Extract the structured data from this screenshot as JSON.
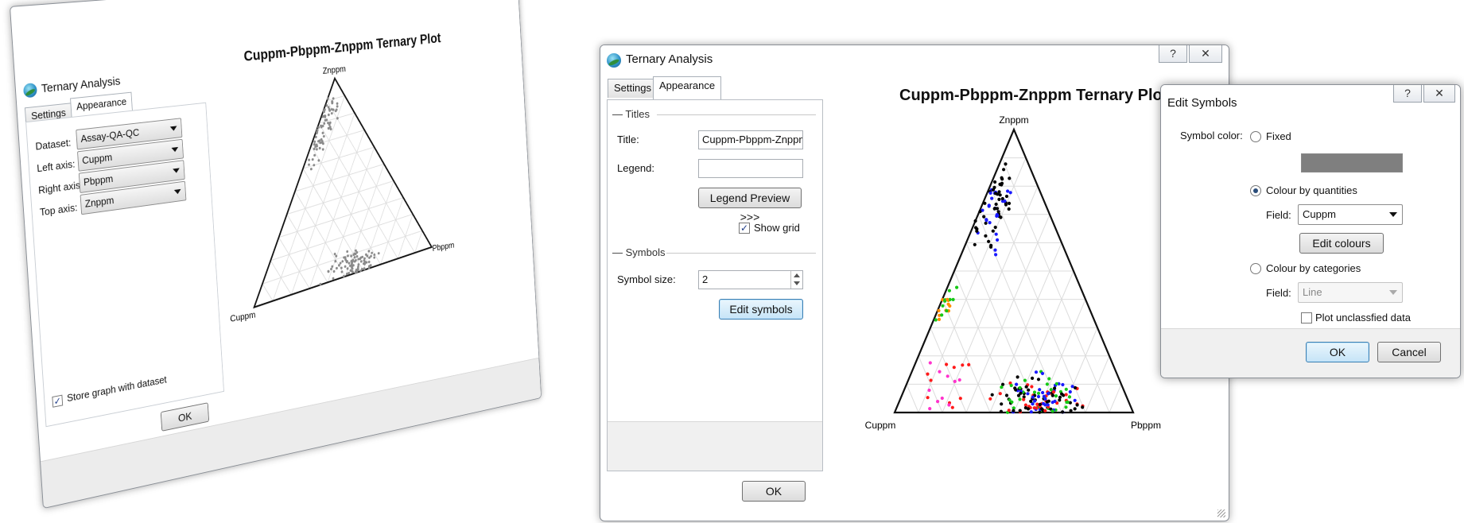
{
  "window_back": {
    "title": "Ternary Analysis",
    "help_glyph": "?",
    "close_glyph": "☒",
    "tabs": [
      "Settings",
      "Appearance"
    ],
    "fields": [
      {
        "label": "Dataset:",
        "value": "Assay-QA-QC"
      },
      {
        "label": "Left axis:",
        "value": "Cuppm"
      },
      {
        "label": "Right axis:",
        "value": "Pbppm"
      },
      {
        "label": "Top axis:",
        "value": "Znppm"
      }
    ],
    "store_graph_label": "Store graph with dataset",
    "store_graph_checked": true,
    "ok_label": "OK",
    "plot": {
      "title": "Cuppm-Pbppm-Znppm Ternary Plot",
      "top_label": "Znppm",
      "left_label": "Cuppm",
      "right_label": "Pbppm",
      "point_color": "#8a8a8a"
    }
  },
  "window_front": {
    "title": "Ternary Analysis",
    "help_glyph": "?",
    "close_glyph": "☒",
    "tabs": [
      "Settings",
      "Appearance"
    ],
    "titles_group": "Titles",
    "title_label": "Title:",
    "title_value": "Cuppm-Pbppm-Znppm T",
    "legend_label": "Legend:",
    "legend_value": "",
    "legend_preview_label": "Legend Preview >>>",
    "show_grid_label": "Show grid",
    "show_grid_checked": true,
    "symbols_group": "Symbols",
    "symbol_size_label": "Symbol size:",
    "symbol_size_value": "2",
    "edit_symbols_label": "Edit symbols",
    "ok_label": "OK",
    "plot": {
      "title": "Cuppm-Pbppm-Znppm Ternary Plot",
      "top_label": "Znppm",
      "left_label": "Cuppm",
      "right_label": "Pbppm",
      "colors": [
        "#000000",
        "#1a1aff",
        "#16c916",
        "#ff1a1a",
        "#ff8c00",
        "#ff33cc"
      ]
    }
  },
  "edit_symbols": {
    "title": "Edit Symbols",
    "help_glyph": "?",
    "close_glyph": "☒",
    "symbol_color_label": "Symbol color:",
    "fixed_label": "Fixed",
    "fixed_swatch_color": "#7f7f7f",
    "by_quantities_label": "Colour by quantities",
    "field_label": "Field:",
    "quantities_field_value": "Cuppm",
    "edit_colours_label": "Edit colours",
    "by_categories_label": "Colour by categories",
    "categories_field_value": "Line",
    "plot_unclassified_label": "Plot unclassfied data",
    "ok_label": "OK",
    "cancel_label": "Cancel",
    "selected_mode": "quantities"
  }
}
